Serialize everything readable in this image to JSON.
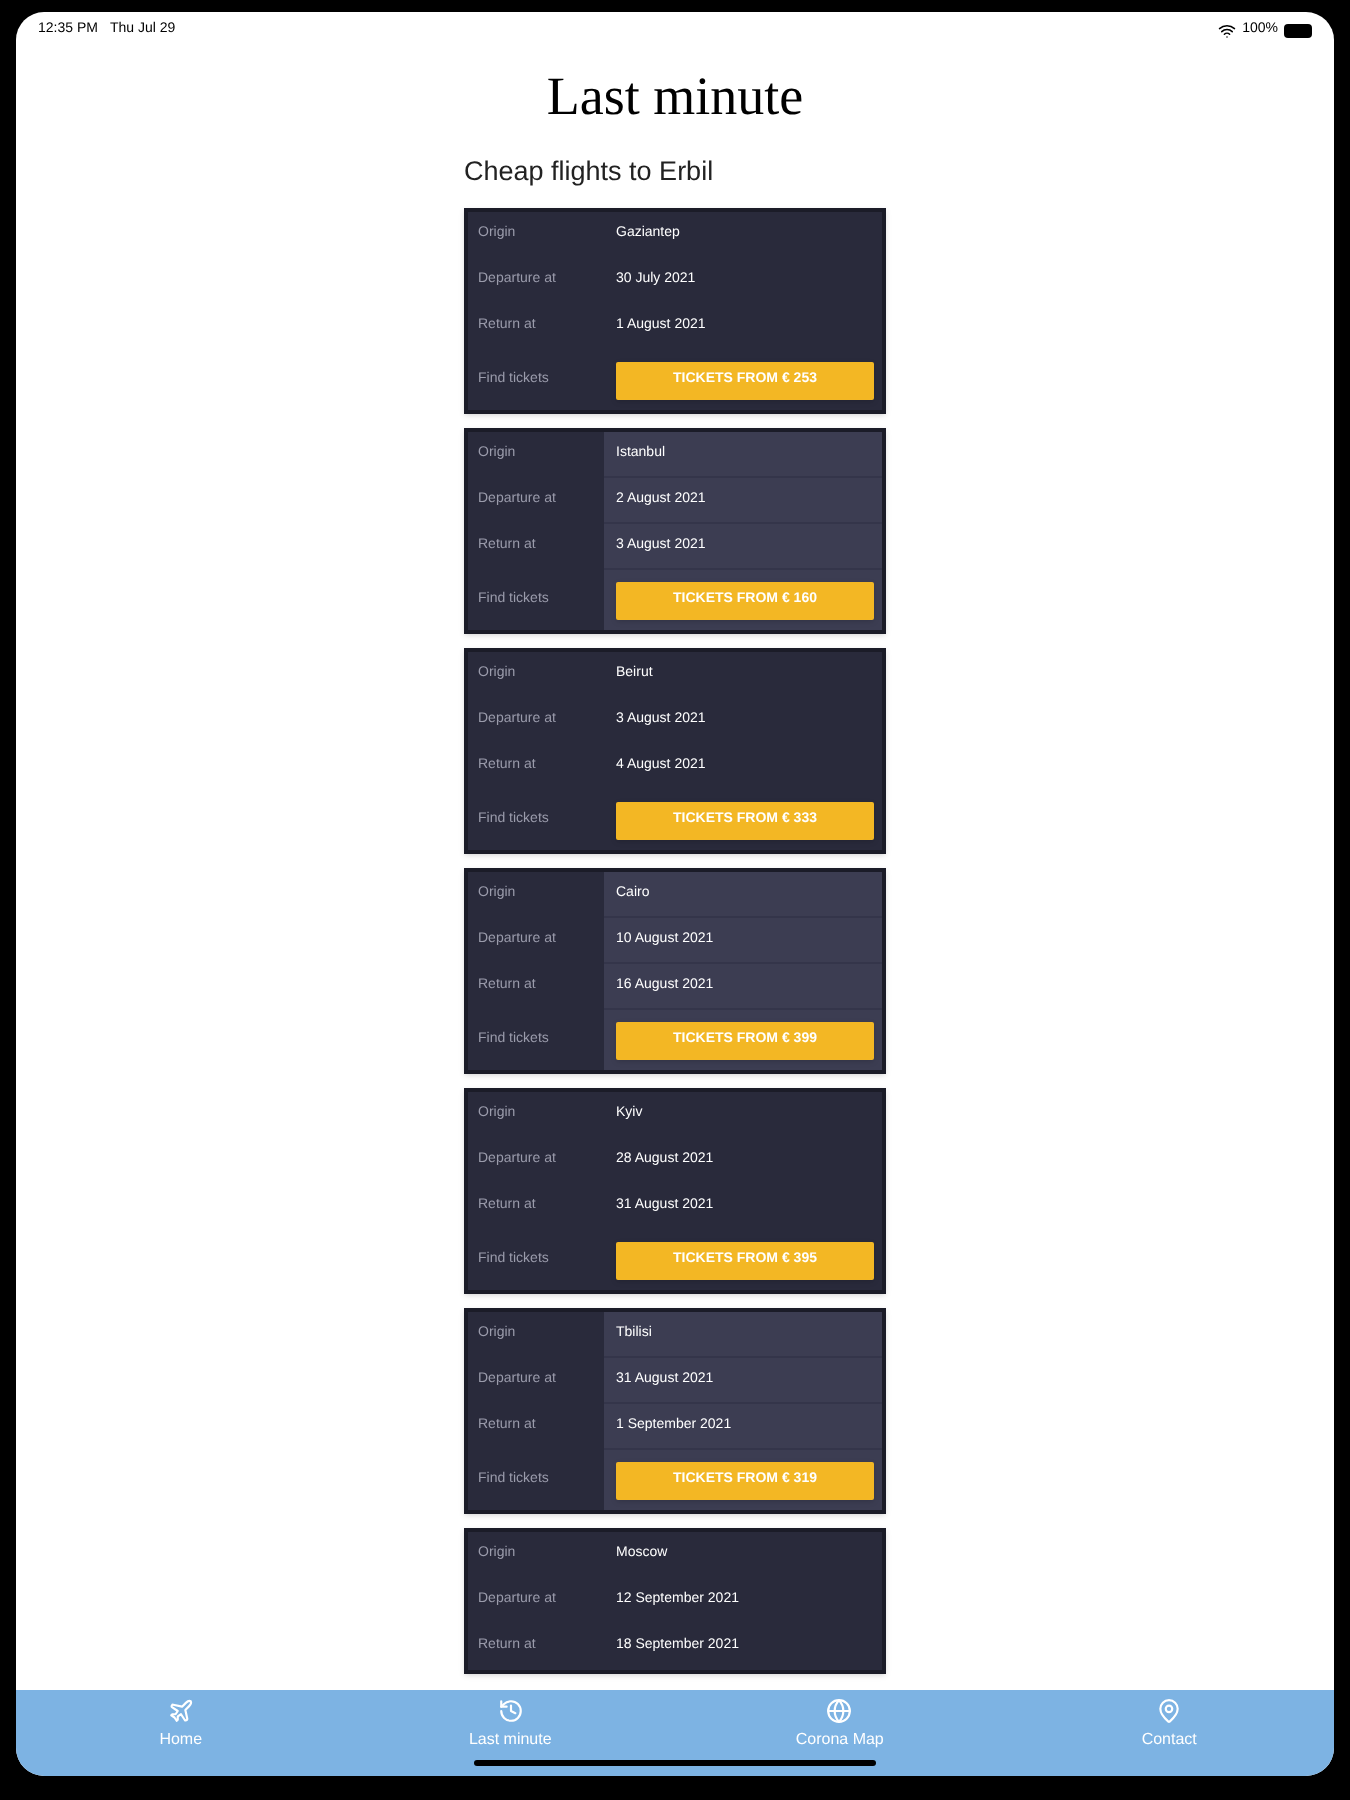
{
  "status_bar": {
    "time": "12:35 PM",
    "date": "Thu Jul 29",
    "battery": "100%"
  },
  "title": "Last minute",
  "subtitle": "Cheap flights to Erbil",
  "flights": [
    {
      "shaded": false,
      "rows": [
        {
          "label": "Origin",
          "value": "Gaziantep"
        },
        {
          "label": "Departure at",
          "value": "30 July 2021"
        },
        {
          "label": "Return at",
          "value": "1 August 2021"
        }
      ],
      "ticket": {
        "label": "Find tickets",
        "button": "TICKETS FROM € 253"
      }
    },
    {
      "shaded": true,
      "rows": [
        {
          "label": "Origin",
          "value": "Istanbul"
        },
        {
          "label": "Departure at",
          "value": "2 August 2021"
        },
        {
          "label": "Return at",
          "value": "3 August 2021"
        }
      ],
      "ticket": {
        "label": "Find tickets",
        "button": "TICKETS FROM € 160"
      }
    },
    {
      "shaded": false,
      "rows": [
        {
          "label": "Origin",
          "value": "Beirut"
        },
        {
          "label": "Departure at",
          "value": "3 August 2021"
        },
        {
          "label": "Return at",
          "value": "4 August 2021"
        }
      ],
      "ticket": {
        "label": "Find tickets",
        "button": "TICKETS FROM € 333"
      }
    },
    {
      "shaded": true,
      "rows": [
        {
          "label": "Origin",
          "value": "Cairo"
        },
        {
          "label": "Departure at",
          "value": "10 August 2021"
        },
        {
          "label": "Return at",
          "value": "16 August 2021"
        }
      ],
      "ticket": {
        "label": "Find tickets",
        "button": "TICKETS FROM € 399"
      }
    },
    {
      "shaded": false,
      "rows": [
        {
          "label": "Origin",
          "value": "Kyiv"
        },
        {
          "label": "Departure at",
          "value": "28 August 2021"
        },
        {
          "label": "Return at",
          "value": "31 August 2021"
        }
      ],
      "ticket": {
        "label": "Find tickets",
        "button": "TICKETS FROM € 395"
      }
    },
    {
      "shaded": true,
      "rows": [
        {
          "label": "Origin",
          "value": "Tbilisi"
        },
        {
          "label": "Departure at",
          "value": "31 August 2021"
        },
        {
          "label": "Return at",
          "value": "1 September 2021"
        }
      ],
      "ticket": {
        "label": "Find tickets",
        "button": "TICKETS FROM € 319"
      }
    },
    {
      "shaded": false,
      "rows": [
        {
          "label": "Origin",
          "value": "Moscow"
        },
        {
          "label": "Departure at",
          "value": "12 September 2021"
        },
        {
          "label": "Return at",
          "value": "18 September 2021"
        }
      ]
    }
  ],
  "tabs": [
    {
      "kind": "home",
      "label": "Home"
    },
    {
      "kind": "recent",
      "label": "Last minute"
    },
    {
      "kind": "map",
      "label": "Corona Map"
    },
    {
      "kind": "contact",
      "label": "Contact"
    }
  ]
}
